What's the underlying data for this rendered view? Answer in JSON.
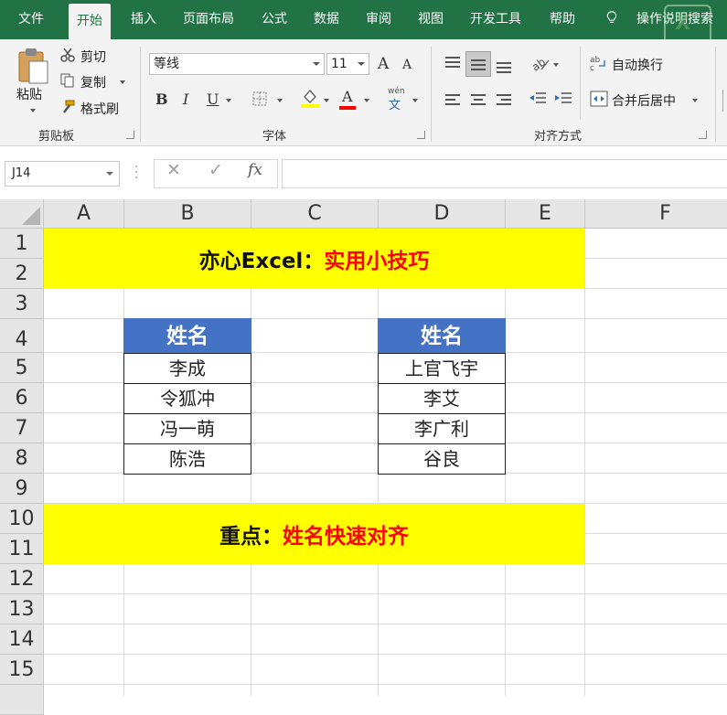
{
  "ribbon_tabs": [
    "文件",
    "开始",
    "插入",
    "页面布局",
    "公式",
    "数据",
    "审阅",
    "视图",
    "开发工具",
    "帮助"
  ],
  "active_tab": "开始",
  "tell_me": "操作说明搜索",
  "watermark_logo": "亦心",
  "clipboard": {
    "paste": "粘贴",
    "cut": "剪切",
    "copy": "复制",
    "format_painter": "格式刷",
    "group_label": "剪贴板"
  },
  "font": {
    "font_name": "等线",
    "font_size": "11",
    "grow_glyph": "A",
    "shrink_glyph": "A",
    "bold_glyph": "B",
    "italic_glyph": "I",
    "underline_glyph": "U",
    "font_color_glyph": "A",
    "phonetic_top": "wén",
    "phonetic_char": "文",
    "group_label": "字体"
  },
  "alignment": {
    "wrap_text": "自动换行",
    "merge_center": "合并后居中",
    "group_label": "对齐方式"
  },
  "formula_bar": {
    "name_box": "J14",
    "cancel_glyph": "✕",
    "enter_glyph": "✓",
    "fx_glyph": "fx",
    "formula": ""
  },
  "columns": [
    "A",
    "B",
    "C",
    "D",
    "E",
    "F"
  ],
  "rows": [
    "1",
    "2",
    "3",
    "4",
    "5",
    "6",
    "7",
    "8",
    "9",
    "10",
    "11",
    "12",
    "13",
    "14",
    "15"
  ],
  "sheet": {
    "title_black": "亦心Excel：",
    "title_red": "实用小技巧",
    "table_left": {
      "header": "姓名",
      "names": [
        "李成",
        "令狐冲",
        "冯一萌",
        "陈浩"
      ]
    },
    "table_right": {
      "header": "姓名",
      "names": [
        "上官飞宇",
        "李艾",
        "李广利",
        "谷良"
      ]
    },
    "note_black": "重点：",
    "note_red": "姓名快速对齐"
  },
  "colors": {
    "ribbon_green": "#217346",
    "banner_yellow": "#ffff00",
    "header_blue": "#4472c4",
    "accent_red": "#ff0000"
  }
}
